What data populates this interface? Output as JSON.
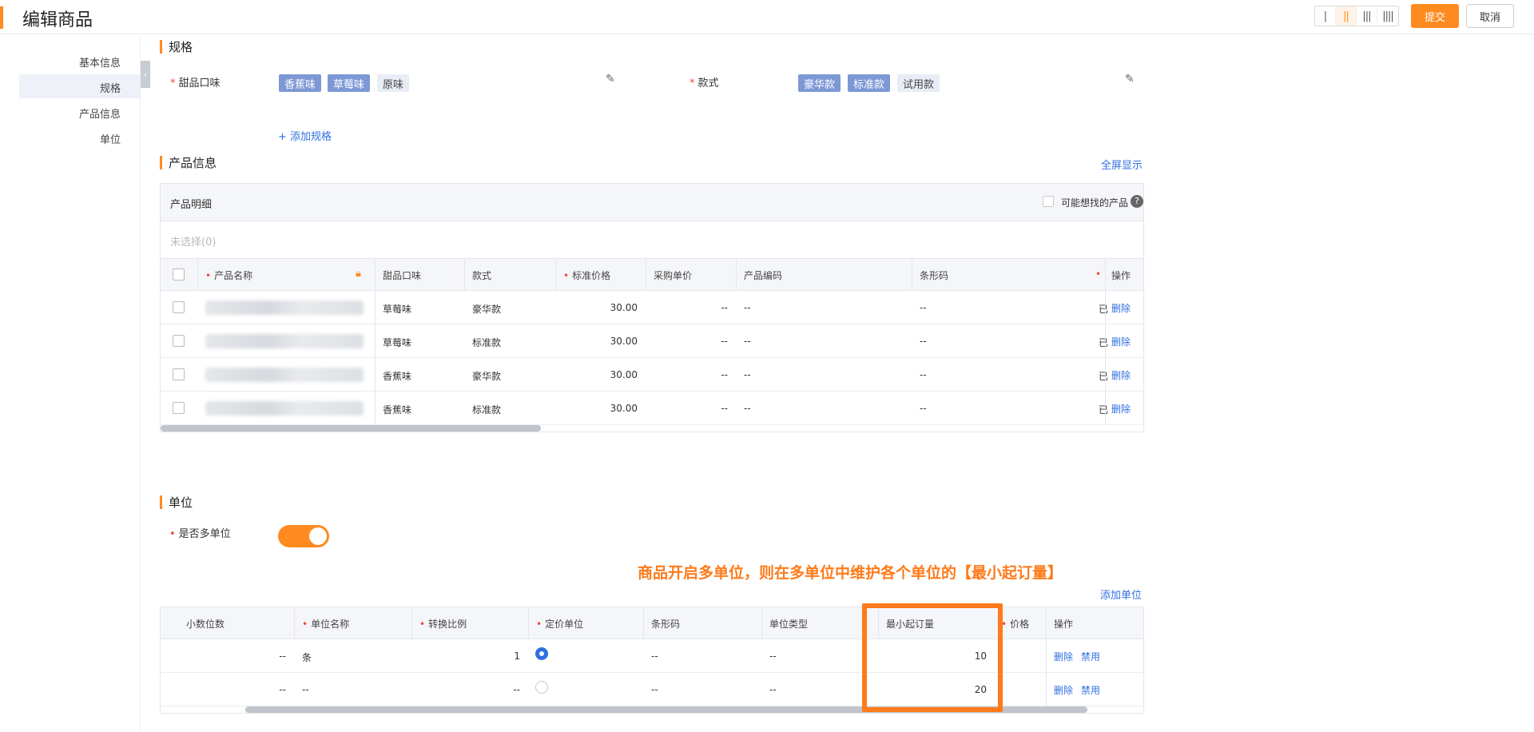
{
  "header": {
    "title": "编辑商品",
    "layout_switch": [
      "|",
      "||",
      "|||",
      "||||"
    ],
    "submit_label": "提交",
    "cancel_label": "取消"
  },
  "nav": {
    "items": [
      "基本信息",
      "规格",
      "产品信息",
      "单位"
    ],
    "collapse_glyph": "‹"
  },
  "spec": {
    "title": "规格",
    "flavor_label": "甜品口味",
    "flavor_tags": [
      {
        "text": "香蕉味",
        "selected": true
      },
      {
        "text": "草莓味",
        "selected": true
      },
      {
        "text": "原味",
        "selected": false
      }
    ],
    "style_label": "款式",
    "style_tags": [
      {
        "text": "豪华款",
        "selected": true
      },
      {
        "text": "标准款",
        "selected": true
      },
      {
        "text": "试用款",
        "selected": false
      }
    ],
    "add_spec": "+ 添加规格"
  },
  "product": {
    "title": "产品信息",
    "fullscreen": "全屏显示",
    "detail_title": "产品明细",
    "maybe_find": "可能想找的产品",
    "help": "?",
    "selected_count": "未选择(0)",
    "columns": [
      "产品名称",
      "甜品口味",
      "款式",
      "标准价格",
      "采购单价",
      "产品编码",
      "条形码",
      "操作"
    ],
    "rows": [
      {
        "flavor": "草莓味",
        "style": "豪华款",
        "price": "30.00",
        "purchase": "--",
        "code": "--",
        "barcode": "--",
        "cut": "已",
        "action": "删除"
      },
      {
        "flavor": "草莓味",
        "style": "标准款",
        "price": "30.00",
        "purchase": "--",
        "code": "--",
        "barcode": "--",
        "cut": "已",
        "action": "删除"
      },
      {
        "flavor": "香蕉味",
        "style": "豪华款",
        "price": "30.00",
        "purchase": "--",
        "code": "--",
        "barcode": "--",
        "cut": "已",
        "action": "删除"
      },
      {
        "flavor": "香蕉味",
        "style": "标准款",
        "price": "30.00",
        "purchase": "--",
        "code": "--",
        "barcode": "--",
        "cut": "已",
        "action": "删除"
      }
    ]
  },
  "unit": {
    "title": "单位",
    "multi_label": "是否多单位",
    "multi_enabled": true,
    "annotation": "商品开启多单位，则在多单位中维护各个单位的【最小起订量】",
    "add_unit": "添加单位",
    "columns": [
      "小数位数",
      "单位名称",
      "转换比例",
      "定价单位",
      "条形码",
      "单位类型",
      "最小起订量",
      "价格",
      "操作"
    ],
    "rows": [
      {
        "decimals": "--",
        "name": "条",
        "ratio": "1",
        "pricing": true,
        "barcode": "--",
        "type": "--",
        "min_order": "10",
        "delete": "删除",
        "disable": "禁用"
      },
      {
        "decimals": "--",
        "name": "--",
        "ratio": "--",
        "pricing": false,
        "barcode": "--",
        "type": "--",
        "min_order": "20",
        "delete": "删除",
        "disable": "禁用"
      }
    ]
  },
  "colors": {
    "accent": "#ff8a1f",
    "link": "#2f6fe0",
    "tag_selected": "#7d98d5",
    "annotation": "#ff7a1a"
  }
}
